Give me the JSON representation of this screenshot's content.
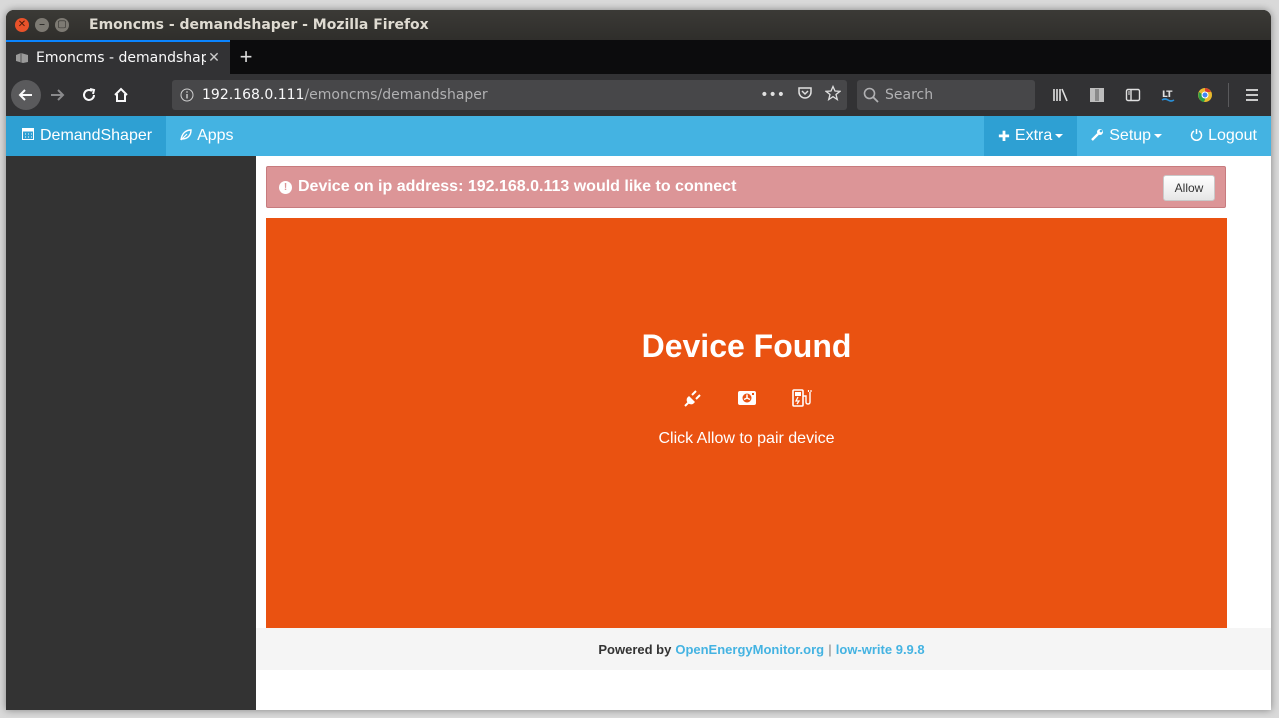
{
  "window": {
    "title": "Emoncms - demandshaper - Mozilla Firefox"
  },
  "tab": {
    "title": "Emoncms - demandshap"
  },
  "urlbar": {
    "host": "192.168.0.111",
    "path": "/emoncms/demandshaper"
  },
  "search": {
    "placeholder": "Search"
  },
  "app_nav": {
    "brand": "DemandShaper",
    "apps": "Apps",
    "extra": "Extra",
    "setup": "Setup",
    "logout": "Logout"
  },
  "alert": {
    "message": "Device on ip address: 192.168.0.113 would like to connect",
    "allow_label": "Allow"
  },
  "device_panel": {
    "title": "Device Found",
    "subtitle": "Click Allow to pair device",
    "icons": [
      "plug-icon",
      "heatpump-icon",
      "ev-charger-icon"
    ]
  },
  "footer": {
    "prefix": "Powered by",
    "link1": "OpenEnergyMonitor.org",
    "separator": "|",
    "link2": "low-write 9.9.8"
  },
  "colors": {
    "nav_blue": "#44b3e2",
    "nav_active": "#2ea0d3",
    "panel_orange": "#ea5211",
    "alert_bg": "#dc9597",
    "sidebar": "#333333"
  }
}
